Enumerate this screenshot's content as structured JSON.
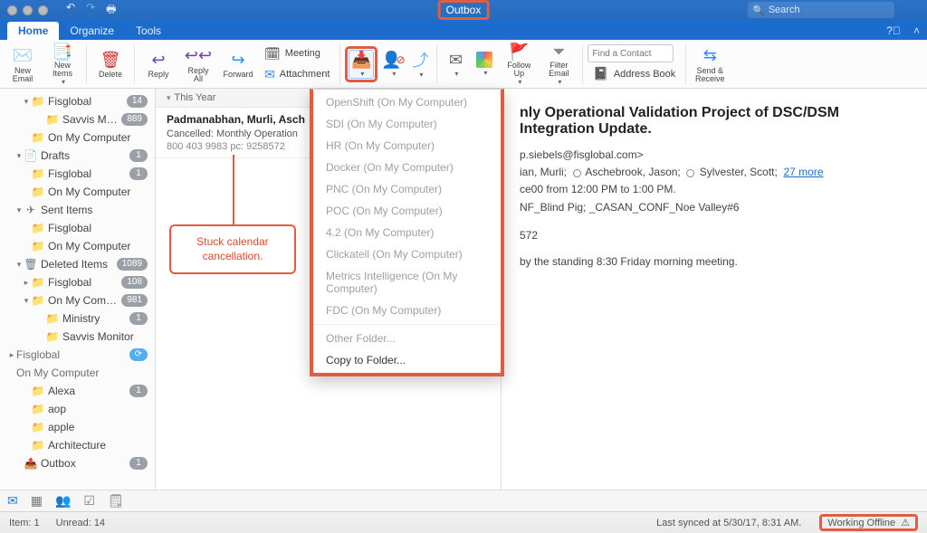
{
  "titlebar": {
    "title": "Outbox",
    "search_placeholder": "Search"
  },
  "tabs": [
    "Home",
    "Organize",
    "Tools"
  ],
  "ribbon": {
    "new_email": "New\nEmail",
    "new_items": "New\nItems",
    "delete": "Delete",
    "reply": "Reply",
    "reply_all": "Reply\nAll",
    "forward": "Forward",
    "meeting": "Meeting",
    "attachment": "Attachment",
    "follow_up": "Follow\nUp",
    "filter_email": "Filter\nEmail",
    "find_contact_placeholder": "Find a Contact",
    "address_book": "Address Book",
    "send_receive": "Send &\nReceive"
  },
  "sidebar": {
    "items": [
      {
        "tri": "▾",
        "icon": "📁",
        "label": "Fisglobal",
        "badge": "14",
        "lvl": 1
      },
      {
        "icon": "📁",
        "label": "Savvis Mon…",
        "badge": "889",
        "lvl": 2
      },
      {
        "icon": "📁",
        "label": "On My Computer",
        "lvl": 1
      },
      {
        "tri": "▾",
        "icon": "📄",
        "label": "Drafts",
        "badge": "1",
        "lvl": 0,
        "bold": true
      },
      {
        "icon": "📁",
        "label": "Fisglobal",
        "badge": "1",
        "lvl": 1
      },
      {
        "icon": "📁",
        "label": "On My Computer",
        "lvl": 1
      },
      {
        "tri": "▾",
        "icon": "✈",
        "label": "Sent Items",
        "lvl": 0,
        "bold": true
      },
      {
        "icon": "📁",
        "label": "Fisglobal",
        "lvl": 1
      },
      {
        "icon": "📁",
        "label": "On My Computer",
        "lvl": 1
      },
      {
        "tri": "▾",
        "icon": "🗑",
        "label": "Deleted Items",
        "badge": "1089",
        "lvl": 0,
        "bold": true
      },
      {
        "tri": "▸",
        "icon": "📁",
        "label": "Fisglobal",
        "badge": "108",
        "lvl": 1
      },
      {
        "tri": "▾",
        "icon": "📁",
        "label": "On My Compu…",
        "badge": "981",
        "lvl": 1
      },
      {
        "icon": "📁",
        "label": "Ministry",
        "badge": "1",
        "lvl": 2
      },
      {
        "icon": "📁",
        "label": "Savvis Monitor",
        "lvl": 2
      },
      {
        "tri": "▸",
        "label": "Fisglobal",
        "section": true,
        "sync": true
      },
      {
        "label": "On My Computer",
        "section": true
      },
      {
        "icon": "📁",
        "label": "Alexa",
        "badge": "1",
        "lvl": 1
      },
      {
        "icon": "📁",
        "label": "aop",
        "lvl": 1
      },
      {
        "icon": "📁",
        "label": "apple",
        "lvl": 1
      },
      {
        "icon": "📁",
        "label": "Architecture",
        "lvl": 1
      },
      {
        "icon": "📤",
        "label": "Outbox",
        "badge": "1",
        "lvl": 0,
        "bold": true
      }
    ]
  },
  "msglist": {
    "group": "This Year",
    "msg": {
      "from": "Padmanabhan, Murli, Asch",
      "subj": "Cancelled: Monthly Operation",
      "prev": "800 403 9983 pc: 9258572"
    }
  },
  "dropdown": {
    "items": [
      "OpenShift (On My Computer)",
      "SDI (On My Computer)",
      "HR (On My Computer)",
      "Docker (On My Computer)",
      "PNC (On My Computer)",
      "POC (On My Computer)",
      "4.2 (On My Computer)",
      "Clickatell (On My Computer)",
      "Metrics Intelligence (On My Computer)",
      "FDC (On My Computer)"
    ],
    "other_folder": "Other Folder...",
    "copy_to_folder": "Copy to Folder..."
  },
  "callout": "Stuck calendar cancellation.",
  "reading": {
    "subject": "nly Operational Validation Project of DSC/DSM Integration Update.",
    "from": "p.siebels@fisglobal.com>",
    "to_1": "ian, Murli;",
    "to_2": "Aschebrook, Jason;",
    "to_3": "Sylvester, Scott;",
    "more_link": "27 more",
    "when": "ce00 from 12:00 PM to 1:00 PM.",
    "where": "NF_Blind Pig; _CASAN_CONF_Noe Valley#6",
    "code": "572",
    "body": "by the standing 8:30 Friday morning meeting."
  },
  "statusbar": {
    "items": "Item: 1",
    "unread": "Unread: 14",
    "last_sync": "Last synced at 5/30/17, 8:31 AM.",
    "offline": "Working Offline"
  }
}
